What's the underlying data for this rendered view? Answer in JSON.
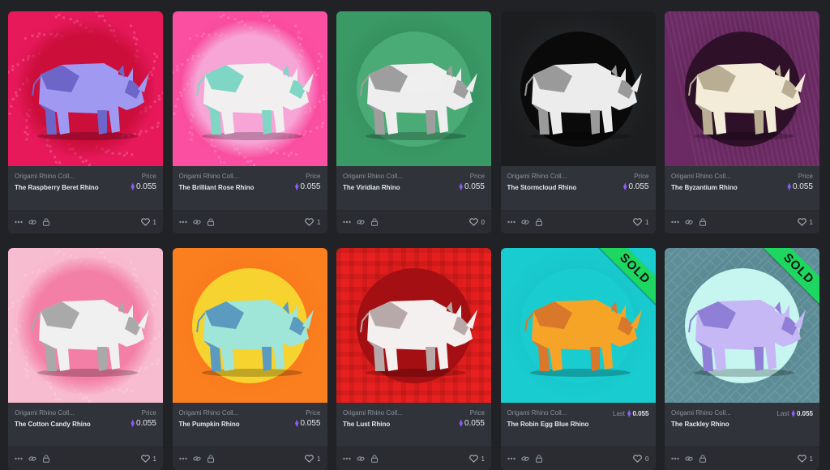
{
  "cards": [
    {
      "collection": "Origami Rhino Coll...",
      "name": "The Raspberry Beret Rhino",
      "price_label": "Price",
      "price": "0.055",
      "last_label": "",
      "last_value": "",
      "likes": "1",
      "sold": false,
      "bg": "#e8195b",
      "bg2": "#c90f47",
      "halo": "#cc0e3b",
      "rhino": "#9f99f2",
      "rhino_dark": "#6d66c8",
      "pattern": "dots"
    },
    {
      "collection": "Origami Rhino Coll...",
      "name": "The Brilliant Rose Rhino",
      "price_label": "Price",
      "price": "0.055",
      "last_label": "",
      "last_value": "",
      "likes": "1",
      "sold": false,
      "bg": "#fb4fa2",
      "bg2": "#f0378d",
      "halo": "#f7a5d6",
      "rhino": "#f1efef",
      "rhino_dark": "#7fd6c5",
      "pattern": "dots"
    },
    {
      "collection": "Origami Rhino Coll...",
      "name": "The Viridian Rhino",
      "price_label": "Price",
      "price": "0.055",
      "last_label": "",
      "last_value": "",
      "likes": "0",
      "sold": false,
      "bg": "#3a9a66",
      "bg2": "#2f7f55",
      "halo": "#4bab76",
      "rhino": "#eeeeee",
      "rhino_dark": "#9e9e9e",
      "pattern": "none"
    },
    {
      "collection": "Origami Rhino Coll...",
      "name": "The Stormcloud Rhino",
      "price_label": "Price",
      "price": "0.055",
      "last_label": "",
      "last_value": "",
      "likes": "1",
      "sold": false,
      "bg": "#1b1d1f",
      "bg2": "#2c2f32",
      "halo": "#0a0a0a",
      "rhino": "#ececec",
      "rhino_dark": "#9a9a9a",
      "pattern": "none"
    },
    {
      "collection": "Origami Rhino Coll...",
      "name": "The Byzantium Rhino",
      "price_label": "Price",
      "price": "0.055",
      "last_label": "",
      "last_value": "",
      "likes": "1",
      "sold": false,
      "bg": "#6b2a63",
      "bg2": "#5a2053",
      "halo": "#2e1028",
      "rhino": "#f3ecd8",
      "rhino_dark": "#b9ae93",
      "pattern": "stripes"
    },
    {
      "collection": "Origami Rhino Coll...",
      "name": "The Cotton Candy Rhino",
      "price_label": "Price",
      "price": "0.055",
      "last_label": "",
      "last_value": "",
      "likes": "1",
      "sold": false,
      "bg": "#f8bcd0",
      "bg2": "#f59dbb",
      "halo": "#f37fa6",
      "rhino": "#f0f0f0",
      "rhino_dark": "#a9a9a9",
      "pattern": "dots"
    },
    {
      "collection": "Origami Rhino Coll...",
      "name": "The Pumpkin Rhino",
      "price_label": "Price",
      "price": "0.055",
      "last_label": "",
      "last_value": "",
      "likes": "1",
      "sold": false,
      "bg": "#fb7f1f",
      "bg2": "#f57016",
      "halo": "#f6d32f",
      "rhino": "#9fe5d8",
      "rhino_dark": "#5b9bbf",
      "pattern": "none"
    },
    {
      "collection": "Origami Rhino Coll...",
      "name": "The Lust Rhino",
      "price_label": "Price",
      "price": "0.055",
      "last_label": "",
      "last_value": "",
      "likes": "1",
      "sold": false,
      "bg": "#e8201f",
      "bg2": "#c91515",
      "halo": "#a30f12",
      "rhino": "#f5f0f0",
      "rhino_dark": "#b7a9a9",
      "pattern": "plaid"
    },
    {
      "collection": "Origami Rhino Coll...",
      "name": "The Robin Egg Blue Rhino",
      "price_label": "",
      "price": "",
      "last_label": "Last",
      "last_value": "0.055",
      "likes": "0",
      "sold": true,
      "sold_label": "SOLD",
      "bg": "#19ccd0",
      "bg2": "#14b8bd",
      "halo": "#19ccd0",
      "rhino": "#f6a427",
      "rhino_dark": "#d9782a",
      "pattern": "none"
    },
    {
      "collection": "Origami Rhino Coll...",
      "name": "The Rackley Rhino",
      "price_label": "",
      "price": "",
      "last_label": "Last",
      "last_value": "0.055",
      "likes": "1",
      "sold": true,
      "sold_label": "SOLD",
      "bg": "#5e8e98",
      "bg2": "#4f7f89",
      "halo": "#c7f5f0",
      "rhino": "#c6b7f5",
      "rhino_dark": "#8f7fd6",
      "pattern": "maze"
    }
  ],
  "icons": {
    "more": "more-dots-icon",
    "link": "link-icon",
    "lock": "lock-icon",
    "heart": "heart-icon",
    "eth": "ethereum-icon"
  },
  "eth_symbol": "⧫"
}
